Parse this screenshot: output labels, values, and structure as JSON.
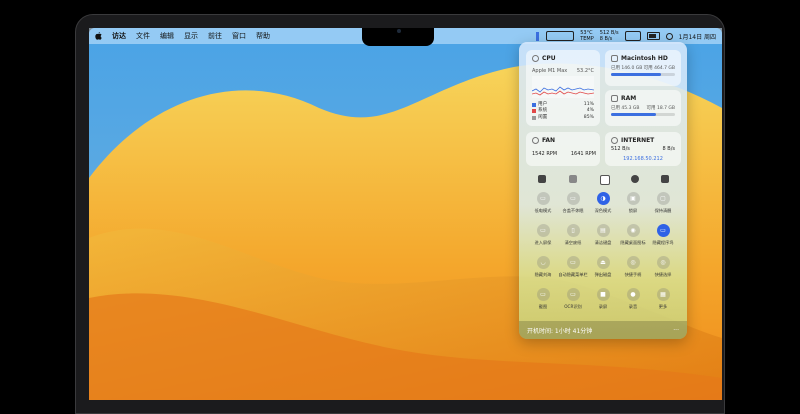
{
  "menubar": {
    "apple_icon": "apple-logo-icon",
    "items": [
      "访达",
      "文件",
      "编辑",
      "显示",
      "前往",
      "窗口",
      "帮助"
    ],
    "status": {
      "temp": "53°C",
      "temp_label": "TEMP",
      "network_up": "512 B/s",
      "network_down": "8 B/s",
      "date": "1月14日 周四"
    }
  },
  "panel": {
    "cpu": {
      "title": "CPU",
      "model": "Apple M1 Max",
      "temp": "53.2°C",
      "legend": [
        {
          "label": "用户",
          "value": "11%",
          "color": "#3b6fe0"
        },
        {
          "label": "系统",
          "value": "4%",
          "color": "#e04848"
        },
        {
          "label": "闲置",
          "value": "85%",
          "color": "#999999"
        }
      ]
    },
    "disk": {
      "title": "Macintosh HD",
      "used_text": "已用 146.0 GB",
      "free_text": "可用 464.7 GB",
      "used_fraction": 0.78
    },
    "ram": {
      "title": "RAM",
      "used_text": "已用 45.3 GB",
      "free_text": "可用 18.7 GB",
      "used_fraction": 0.7
    },
    "fan": {
      "title": "FAN",
      "fan1": "1542 RPM",
      "fan2": "1641 RPM"
    },
    "internet": {
      "title": "INTERNET",
      "down": "512 B/s",
      "up": "8 B/s",
      "ip": "192.168.50.212"
    },
    "toggles": [
      {
        "label": "低电模式",
        "on": false,
        "icon": "battery-icon"
      },
      {
        "label": "合盖不休眠",
        "on": false,
        "icon": "laptop-icon"
      },
      {
        "label": "深色模式",
        "on": true,
        "icon": "contrast-icon"
      },
      {
        "label": "锁屏",
        "on": false,
        "icon": "lock-icon"
      },
      {
        "label": "保持清醒",
        "on": false,
        "icon": "display-icon"
      },
      {
        "label": "进入屏保",
        "on": false,
        "icon": "screensaver-icon"
      },
      {
        "label": "清空废纸",
        "on": false,
        "icon": "trash-icon"
      },
      {
        "label": "清洁键盘",
        "on": false,
        "icon": "keyboard-icon"
      },
      {
        "label": "隐藏桌面图标",
        "on": false,
        "icon": "eye-icon"
      },
      {
        "label": "隐藏程序坞",
        "on": true,
        "icon": "dock-icon"
      },
      {
        "label": "隐藏刘海",
        "on": false,
        "icon": "notch-icon"
      },
      {
        "label": "自动隐藏菜单栏",
        "on": false,
        "icon": "menubar-icon"
      },
      {
        "label": "弹出磁盘",
        "on": false,
        "icon": "eject-icon"
      },
      {
        "label": "快捷手柄",
        "on": false,
        "icon": "gamepad-icon"
      },
      {
        "label": "快捷选择",
        "on": false,
        "icon": "picker-icon"
      },
      {
        "label": "截图",
        "on": false,
        "icon": "screenshot-icon"
      },
      {
        "label": "OCR识别",
        "on": false,
        "icon": "ocr-icon"
      },
      {
        "label": "录屏",
        "on": false,
        "icon": "record-icon"
      },
      {
        "label": "录音",
        "on": false,
        "icon": "mic-icon"
      },
      {
        "label": "更多",
        "on": false,
        "icon": "grid-icon"
      }
    ],
    "uptime": "开机时间: 1小时 41分钟",
    "more_label": "···"
  }
}
